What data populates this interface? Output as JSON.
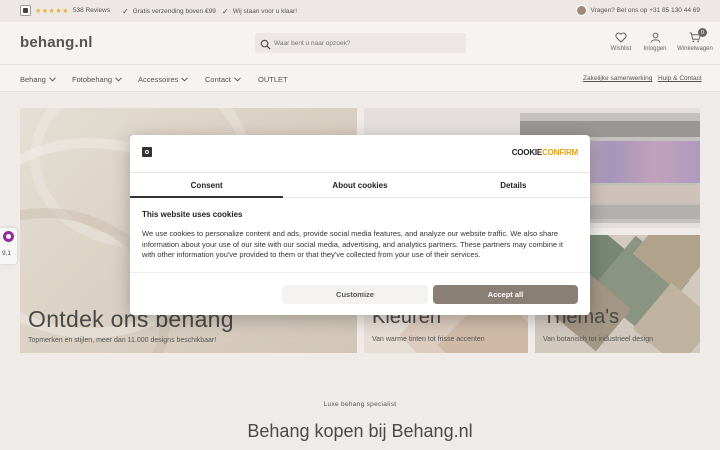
{
  "topbar": {
    "reviews": "538 Reviews",
    "stars": "★★★★★",
    "usp1": "Gratis verzending boven €99",
    "usp2": "Wij staan voor u klaar!",
    "help": "Vragen? Bel ons op +31 85 130 44 69"
  },
  "header": {
    "logo": "behang.nl",
    "search_placeholder": "Waar bent u naar opzoek?",
    "wishlist": "Wishlist",
    "login": "Inloggen",
    "cart": "Winkelwagen",
    "cart_count": "0"
  },
  "nav": {
    "items": [
      "Behang",
      "Fotobehang",
      "Accessoires",
      "Contact",
      "OUTLET"
    ],
    "links": [
      "Zakelijke samenwerking",
      "Hulp & Contact"
    ]
  },
  "hero": {
    "title": "Ontdek ons behang",
    "subtitle": "Topmerken en stijlen, meer dan 11.000 designs beschikbaar!"
  },
  "tiles": [
    {
      "title": "Kleuren",
      "subtitle": "Van warme tinten tot frisse accenten"
    },
    {
      "title": "Thema's",
      "subtitle": "Van botanisch tot industrieel design"
    }
  ],
  "side_widget": {
    "score": "9,1"
  },
  "modal": {
    "brand_part1": "COOKIE",
    "brand_part2": "CONFIRM",
    "tabs": [
      "Consent",
      "About cookies",
      "Details"
    ],
    "heading": "This website uses cookies",
    "text": "We use cookies to personalize content and ads, provide social media features, and analyze our website traffic. We also share information about your use of our site with our social media, advertising, and analytics partners. These partners may combine it with other information you've provided to them or that they've collected from your use of their services.",
    "customize": "Customize",
    "accept": "Accept all"
  },
  "section": {
    "kicker": "Luxe behang specialist",
    "title": "Behang kopen bij Behang.nl"
  },
  "colors": {
    "accent": "#8a7f74",
    "background": "#f6f3f1",
    "star": "#e8b23c"
  }
}
